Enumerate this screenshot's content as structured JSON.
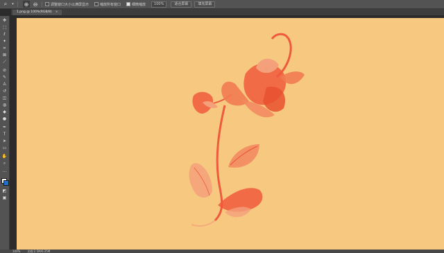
{
  "options_bar": {
    "zoom_in_icon": "zoom-in",
    "zoom_out_icon": "zoom-out",
    "checkbox_resize": "调整窗口大小以满屏显示",
    "checkbox_all_windows": "缩放所有窗口",
    "checkbox_scrubby": "细微缩放",
    "zoom_percent": "100%",
    "fit_screen_button": "适合屏幕",
    "fill_screen_button": "填充屏幕"
  },
  "document_tab": {
    "title": "1.png @ 100%(RGB/8)",
    "close": "×"
  },
  "status_bar": {
    "zoom": "100%",
    "doc_info": "文档:2.5M/6.25M"
  },
  "colors": {
    "background": "#f7c87f",
    "flower": "#ee5a3c",
    "ui_dark": "#2b2b2b",
    "ui_mid": "#535353"
  }
}
